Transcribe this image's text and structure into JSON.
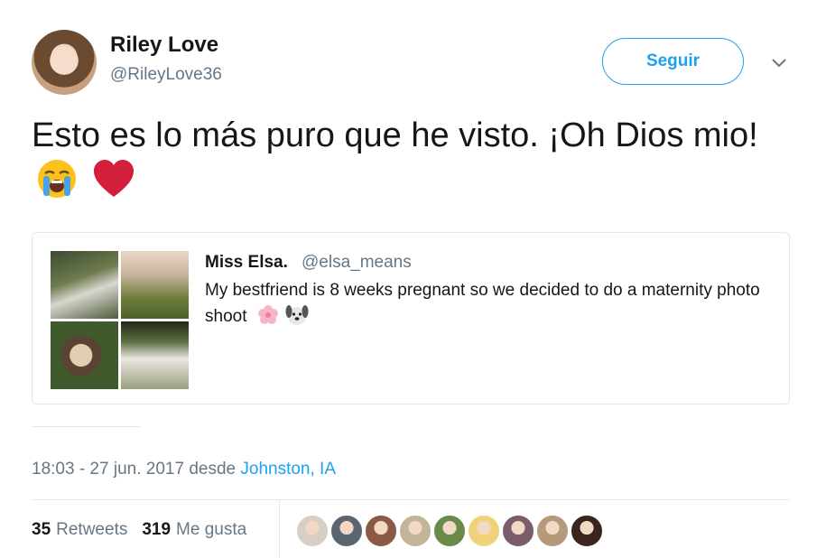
{
  "author": {
    "name": "Riley Love",
    "handle": "@RileyLove36"
  },
  "follow_button_label": "Seguir",
  "tweet": {
    "text": "Esto es lo más puro que he visto. ¡Oh Dios mio!",
    "emojis": [
      "loudly-crying-face",
      "red-heart"
    ]
  },
  "quoted_tweet": {
    "name": "Miss Elsa.",
    "handle": "@elsa_means",
    "text": "My bestfriend is 8 weeks pregnant so we decided to do a maternity photo shoot",
    "emojis": [
      "cherry-blossom",
      "dog-face"
    ],
    "photo_count": 4
  },
  "timestamp": {
    "time_date": "18:03 - 27 jun. 2017",
    "from_word": "desde",
    "place": "Johnston, IA"
  },
  "stats": {
    "retweets_count": "35",
    "retweets_label": "Retweets",
    "likes_count": "319",
    "likes_label": "Me gusta"
  },
  "liker_avatar_colors": [
    "#d8cfc4",
    "#5a6570",
    "#8a5a44",
    "#c4b49a",
    "#6a8a4a",
    "#f0d27a",
    "#7a5c6a",
    "#b49a7a",
    "#3a2420"
  ],
  "colors": {
    "accent": "#1da1f2",
    "secondary_text": "#657786",
    "primary_text": "#14171a",
    "border": "#e1e8ed"
  }
}
